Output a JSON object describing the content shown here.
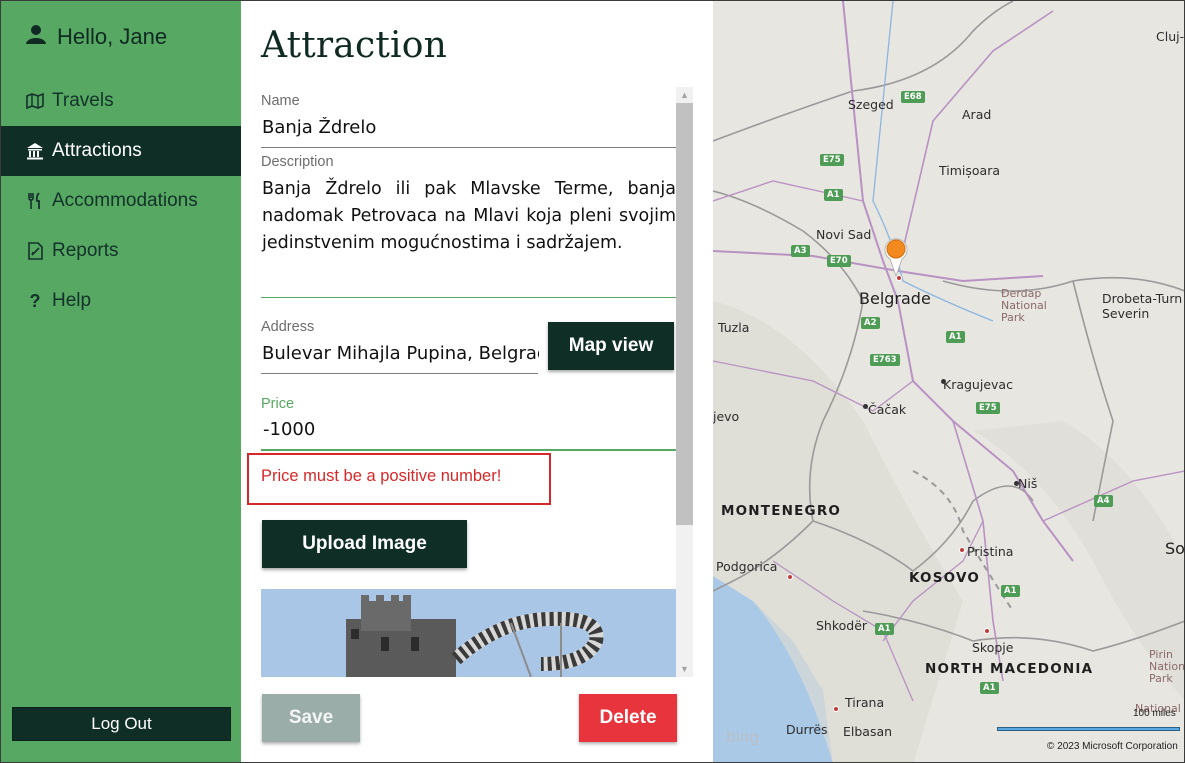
{
  "sidebar": {
    "greeting": "Hello, Jane",
    "items": [
      {
        "label": "Travels",
        "icon": "map-icon"
      },
      {
        "label": "Attractions",
        "icon": "bank-icon",
        "active": true
      },
      {
        "label": "Accommodations",
        "icon": "cutlery-icon"
      },
      {
        "label": "Reports",
        "icon": "report-icon"
      },
      {
        "label": "Help",
        "icon": "question-icon"
      }
    ],
    "logout_label": "Log Out"
  },
  "form": {
    "title": "Attraction",
    "name_label": "Name",
    "name_value": "Banja Ždrelo",
    "description_label": "Description",
    "description_value": "Banja Ždrelo ili pak Mlavske Terme, banja nadomak Petrovaca na Mlavi koja pleni svojim jedinstvenim mogućnostima i sadržajem.",
    "address_label": "Address",
    "address_value": "Bulevar Mihajla Pupina, Belgrad",
    "map_view_label": "Map view",
    "price_label": "Price",
    "price_value": "-1000",
    "price_error": "Price must be a positive number!",
    "upload_label": "Upload Image",
    "save_label": "Save",
    "delete_label": "Delete"
  },
  "map": {
    "labels": {
      "cluj": "Cluj-N",
      "szeged": "Szeged",
      "arad": "Arad",
      "timisoara": "Timișoara",
      "novi_sad": "Novi Sad",
      "belgrade": "Belgrade",
      "drobeta": "Drobeta-Turn",
      "severin": "Severin",
      "djerdap": "Đerdap\nNational\nPark",
      "tuzla": "Tuzla",
      "kragujevac": "Kragujevac",
      "cacak": "Čačak",
      "jevo": "jevo",
      "nis": "Niš",
      "montenegro": "MONTENEGRO",
      "pristina": "Pristina",
      "so": "So",
      "podgorica": "Podgorica",
      "kosovo": "KOSOVO",
      "shkoder": "Shkodër",
      "skopje": "Skopje",
      "north_macedonia": "NORTH MACEDONIA",
      "pirin": "Pirin\nNation\nPark",
      "tirana": "Tirana",
      "durres": "Durrës",
      "elbasan": "Elbasan",
      "national": "National"
    },
    "shields": [
      "E68",
      "E75",
      "A1",
      "A3",
      "E70",
      "A2",
      "A1",
      "E763",
      "E75",
      "A4",
      "A1",
      "A1",
      "A1"
    ],
    "bing_label": "bing",
    "scale_label": "100 miles",
    "copyright": "© 2023 Microsoft Corporation"
  },
  "colors": {
    "sidebar_bg": "#57a862",
    "accent_dark": "#0e2e26",
    "error": "#d62828",
    "delete": "#e8343c"
  }
}
